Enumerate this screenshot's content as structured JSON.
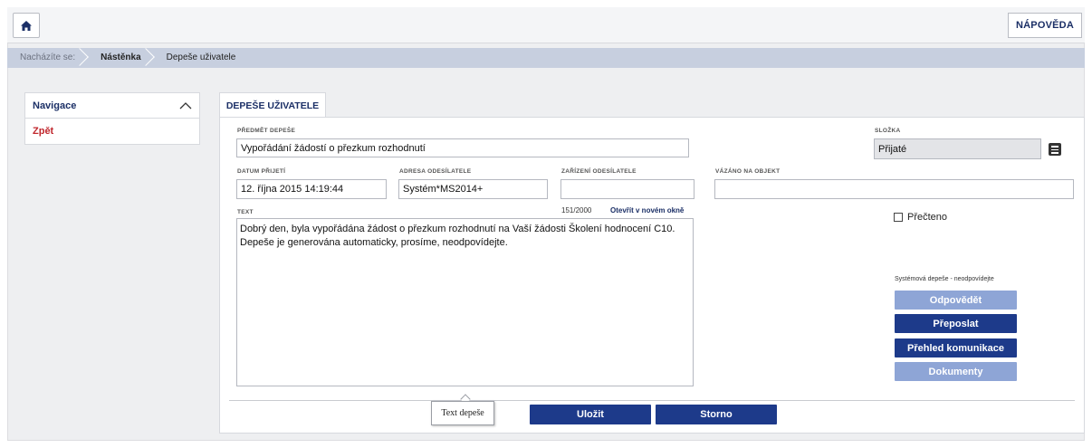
{
  "header": {
    "help_label": "NÁPOVĚDA"
  },
  "breadcrumb": {
    "items": [
      "Nacházíte se:",
      "Nástěnka",
      "Depeše uživatele"
    ]
  },
  "navigation": {
    "title": "Navigace",
    "items": [
      {
        "label": "Zpět"
      }
    ]
  },
  "tab": {
    "label": "DEPEŠE UŽIVATELE"
  },
  "form": {
    "subject": {
      "label": "PŘEDMĚT DEPEŠE",
      "value": "Vypořádání žádostí o přezkum rozhodnutí"
    },
    "folder": {
      "label": "SLOŽKA",
      "value": "Přijaté"
    },
    "date": {
      "label": "DATUM PŘIJETÍ",
      "value": "12. října 2015 14:19:44"
    },
    "sender_address": {
      "label": "ADRESA ODESÍLATELE",
      "value": "Systém*MS2014+"
    },
    "sender_device": {
      "label": "ZAŘÍZENÍ ODESÍLATELE",
      "value": ""
    },
    "bound_object": {
      "label": "VÁZÁNO NA OBJEKT",
      "value": ""
    },
    "text": {
      "label": "TEXT",
      "counter": "151/2000",
      "open_link": "Otevřít v novém okně",
      "value": "Dobrý den, byla vypořádána žádost o přezkum rozhodnutí na Vaší žádosti Školení hodnocení C10. Depeše je generována automaticky, prosíme, neodpovídejte."
    },
    "read_checkbox": {
      "label": "Přečteno",
      "checked": false
    },
    "system_note": "Systémová depeše - neodpovídejte"
  },
  "actions": {
    "reply": "Odpovědět",
    "forward": "Přeposlat",
    "overview": "Přehled komunikace",
    "documents": "Dokumenty",
    "save": "Uložit",
    "cancel": "Storno"
  },
  "tooltip": {
    "text": "Text depeše"
  },
  "colors": {
    "primary": "#1d3a8a",
    "disabled": "#8ea5d6",
    "breadcrumb": "#c7cfdf",
    "back_link": "#c0272d"
  },
  "icons": {
    "home": "home-icon",
    "collapse": "chevron-up-icon",
    "folder_menu": "list-menu-icon"
  }
}
